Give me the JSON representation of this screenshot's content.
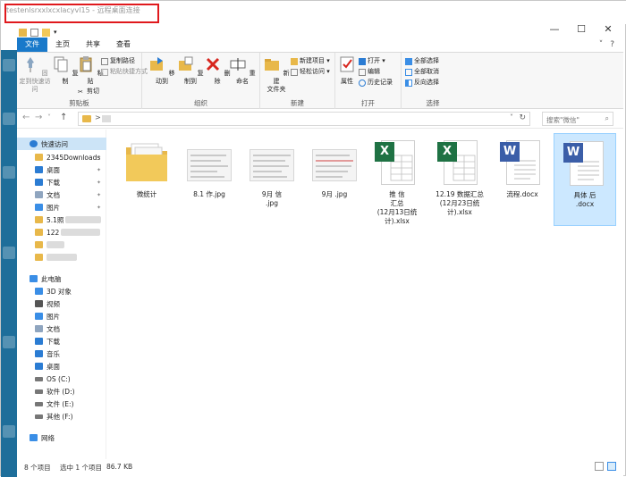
{
  "window": {
    "rdp_title": "testenlsrxxlxcxlacyvl15 - 远程桌面连接",
    "minimize": "—",
    "maximize": "☐",
    "close": "✕"
  },
  "tabs": [
    {
      "label": "文件",
      "active": true
    },
    {
      "label": "主页"
    },
    {
      "label": "共享"
    },
    {
      "label": "查看"
    }
  ],
  "ribbon_right": {
    "collapse": "˅",
    "help": "?"
  },
  "ribbon": {
    "clipboard": {
      "label": "剪贴板",
      "pin_quick": "固定到快速访问",
      "copy": "复制",
      "paste": "粘贴",
      "copy_path": "复制路径",
      "paste_shortcut": "粘贴快捷方式",
      "cut": "剪切"
    },
    "organize": {
      "label": "组织",
      "move_to": "移动到",
      "copy_to": "复制到",
      "delete": "删除",
      "rename": "重命名"
    },
    "new": {
      "label": "新建",
      "new_folder": "新建\n文件夹",
      "new_item": "新建项目 ▾",
      "easy_access": "轻松访问 ▾"
    },
    "open": {
      "label": "打开",
      "properties": "属性",
      "open": "打开 ▾",
      "edit": "编辑",
      "history": "历史记录"
    },
    "select": {
      "label": "选择",
      "select_all": "全部选择",
      "select_none": "全部取消",
      "invert": "反向选择"
    }
  },
  "address": {
    "back": "←",
    "forward": "→",
    "recent": "˅",
    "up": "↑",
    "separator": ">",
    "dropdown": "˅",
    "refresh": "↻",
    "search_placeholder": "搜索\"微信\"",
    "search_icon": "⌕"
  },
  "nav": {
    "quick_access": "快速访问",
    "items": [
      {
        "label": "2345Downloads",
        "color": "#e8b84a",
        "pin": true
      },
      {
        "label": "桌面",
        "color": "#2b7cd3",
        "pin": true
      },
      {
        "label": "下载",
        "color": "#2b7cd3",
        "pin": true
      },
      {
        "label": "文档",
        "color": "#8fa5bf",
        "pin": true
      },
      {
        "label": "图片",
        "color": "#3a8ee6",
        "pin": true
      },
      {
        "label": "5.1照",
        "color": "#e8b84a"
      },
      {
        "label": "122",
        "color": "#e8b84a"
      },
      {
        "label": "",
        "color": "#e8b84a"
      },
      {
        "label": "",
        "color": "#e8b84a"
      }
    ],
    "this_pc": "此电脑",
    "pc_items": [
      {
        "label": "3D 对象",
        "color": "#3a8ee6"
      },
      {
        "label": "视频",
        "color": "#555"
      },
      {
        "label": "图片",
        "color": "#3a8ee6"
      },
      {
        "label": "文档",
        "color": "#8fa5bf"
      },
      {
        "label": "下载",
        "color": "#2b7cd3"
      },
      {
        "label": "音乐",
        "color": "#2b7cd3"
      },
      {
        "label": "桌面",
        "color": "#2b7cd3"
      },
      {
        "label": "OS (C:)",
        "color": "#777"
      },
      {
        "label": "软件 (D:)",
        "color": "#777"
      },
      {
        "label": "文件 (E:)",
        "color": "#777"
      },
      {
        "label": "其他 (F:)",
        "color": "#777"
      }
    ],
    "network": "网络",
    "pin_glyph": "✦"
  },
  "files": [
    {
      "type": "folder",
      "label": "微统计"
    },
    {
      "type": "image",
      "label": "8.1 作.jpg"
    },
    {
      "type": "image",
      "label": "9月 信\n.jpg"
    },
    {
      "type": "image",
      "label": "9月 .jpg"
    },
    {
      "type": "xlsx",
      "label": "推 信\n 汇总\n(12月13日统\n计).xlsx",
      "glyph": "X"
    },
    {
      "type": "xlsx",
      "label": "12.19 数据汇总\n(12月23日统\n计).xlsx",
      "glyph": "X"
    },
    {
      "type": "docx",
      "label": "流程.docx",
      "glyph": "W"
    },
    {
      "type": "docx",
      "label": "具体 后\n.docx",
      "glyph": "W",
      "selected": true
    }
  ],
  "status": {
    "count": "8 个项目",
    "selected": "选中 1 个项目",
    "size": "86.7 KB"
  }
}
